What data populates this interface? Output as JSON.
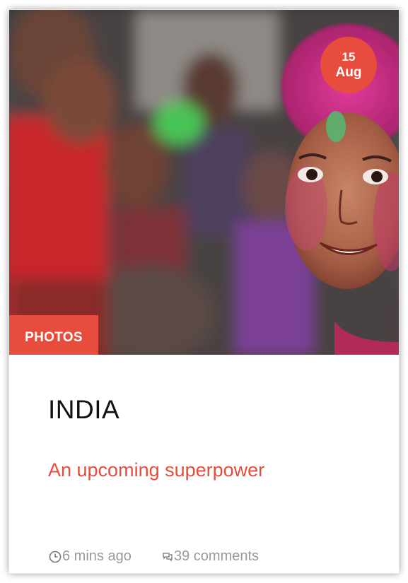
{
  "post": {
    "date": {
      "day": "15",
      "month": "Aug"
    },
    "category": "PHOTOS",
    "title": "INDIA",
    "subtitle": "An upcoming superpower",
    "meta": {
      "time": "6 mins ago",
      "comments": "39 comments"
    }
  },
  "icons": {
    "time": "clock-icon",
    "comments": "comments-icon"
  },
  "colors": {
    "accent": "#e74c3c",
    "meta_text": "#999999",
    "title_text": "#111111"
  }
}
